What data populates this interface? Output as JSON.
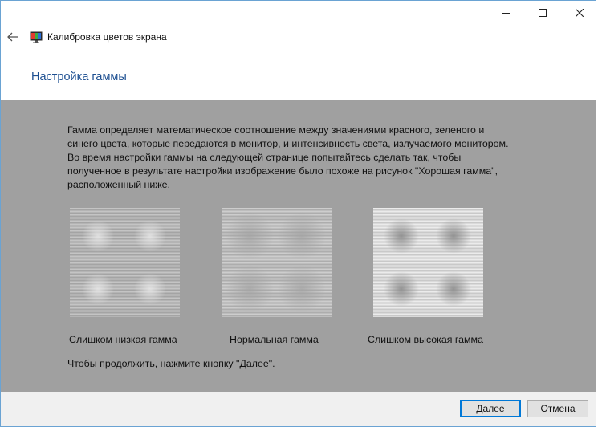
{
  "window": {
    "title": "Калибровка цветов экрана",
    "icons": {
      "back": "back-arrow-icon",
      "app": "monitor-color-icon",
      "minimize": "minimize-icon",
      "maximize": "maximize-icon",
      "close": "close-icon"
    }
  },
  "page": {
    "title": "Настройка гаммы",
    "paragraph1": "Гамма определяет математическое соотношение между значениями красного, зеленого и синего цвета, которые передаются в монитор, и интенсивность света, излучаемого монитором.",
    "paragraph2": "Во время настройки гаммы на следующей странице попытайтесь сделать так, чтобы полученное в результате настройки изображение было похоже на рисунок \"Хорошая гамма\", расположенный ниже.",
    "continue_hint": "Чтобы продолжить, нажмите кнопку \"Далее\"."
  },
  "samples": [
    {
      "caption": "Слишком низкая гамма",
      "mode": "low"
    },
    {
      "caption": "Нормальная гамма",
      "mode": "normal"
    },
    {
      "caption": "Слишком высокая гамма",
      "mode": "high"
    }
  ],
  "footer": {
    "next_label": "Далее",
    "cancel_label": "Отмена"
  },
  "colors": {
    "accent": "#1d4f91",
    "content_bg": "#a0a0a0",
    "focus_border": "#0078d7"
  }
}
